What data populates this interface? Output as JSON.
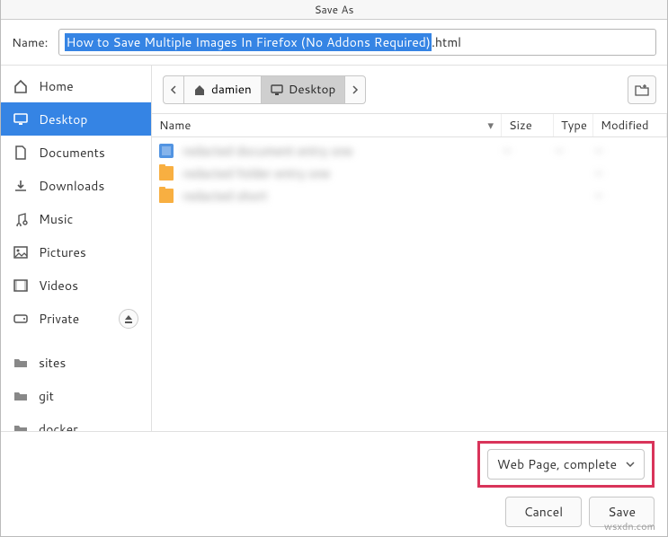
{
  "title": "Save As",
  "name_label": "Name:",
  "filename_selected": "How to Save Multiple Images In Firefox (No Addons Required)",
  "filename_ext": ".html",
  "sidebar": {
    "items": [
      {
        "icon": "home",
        "label": "Home"
      },
      {
        "icon": "desktop",
        "label": "Desktop",
        "active": true
      },
      {
        "icon": "documents",
        "label": "Documents"
      },
      {
        "icon": "downloads",
        "label": "Downloads"
      },
      {
        "icon": "music",
        "label": "Music"
      },
      {
        "icon": "pictures",
        "label": "Pictures"
      },
      {
        "icon": "videos",
        "label": "Videos"
      },
      {
        "icon": "drive",
        "label": "Private",
        "eject": true
      }
    ],
    "other": [
      {
        "icon": "folder",
        "label": "sites"
      },
      {
        "icon": "folder",
        "label": "git"
      },
      {
        "icon": "folder",
        "label": "docker"
      }
    ]
  },
  "path": {
    "parts": [
      "damien",
      "Desktop"
    ]
  },
  "columns": {
    "name": "Name",
    "size": "Size",
    "type": "Type",
    "modified": "Modified"
  },
  "files": [
    {
      "kind": "doc",
      "name": "redacted document entry one",
      "size": "—",
      "type": "—",
      "mod": "—"
    },
    {
      "kind": "folder",
      "name": "redacted folder entry one",
      "size": "",
      "type": "",
      "mod": "—"
    },
    {
      "kind": "folder",
      "name": "redacted short",
      "size": "",
      "type": "",
      "mod": "—"
    }
  ],
  "filter_label": "Web Page, complete",
  "buttons": {
    "cancel": "Cancel",
    "save": "Save"
  },
  "watermark": "wsxdn.com"
}
